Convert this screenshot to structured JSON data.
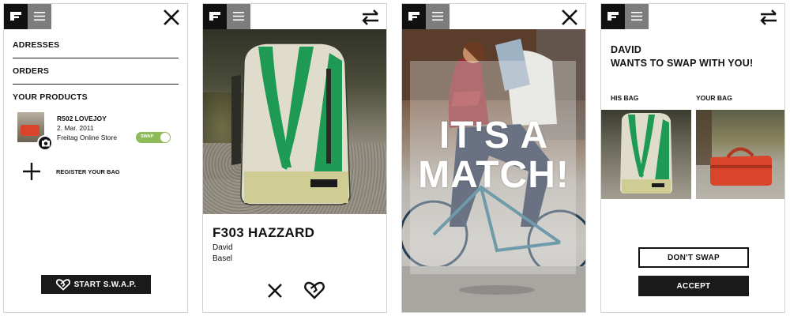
{
  "screens": {
    "menu": {
      "nav": [
        "ADRESSES",
        "ORDERS",
        "YOUR PRODUCTS"
      ],
      "product": {
        "name": "R502 LOVEJOY",
        "date": "2. Mar. 2011",
        "store": "Freitag Online Store",
        "toggle_label": "SWAP",
        "toggle_on": true
      },
      "register_label": "REGISTER YOUR BAG",
      "start_label": "START S.W.A.P."
    },
    "product_view": {
      "title": "F303 HAZZARD",
      "owner": "David",
      "city": "Basel"
    },
    "match": {
      "line1": "IT'S A",
      "line2": "MATCH!"
    },
    "swap_request": {
      "name": "DAVID",
      "message": "WANTS TO SWAP WITH YOU!",
      "his_bag_label": "HIS BAG",
      "your_bag_label": "YOUR BAG",
      "decline_label": "DON'T SWAP",
      "accept_label": "ACCEPT"
    }
  },
  "icons": {
    "logo": "freitag-logo-icon",
    "menu": "hamburger-icon",
    "close": "close-icon",
    "swap": "swap-arrows-icon",
    "camera": "camera-icon",
    "add": "plus-icon",
    "heart": "heart-icon"
  },
  "colors": {
    "primary": "#1a1a1a",
    "header_menu": "#7d7d7d",
    "toggle_on": "#8dbb58",
    "bag_green": "#1f9a55",
    "bag_red": "#d9452b"
  }
}
